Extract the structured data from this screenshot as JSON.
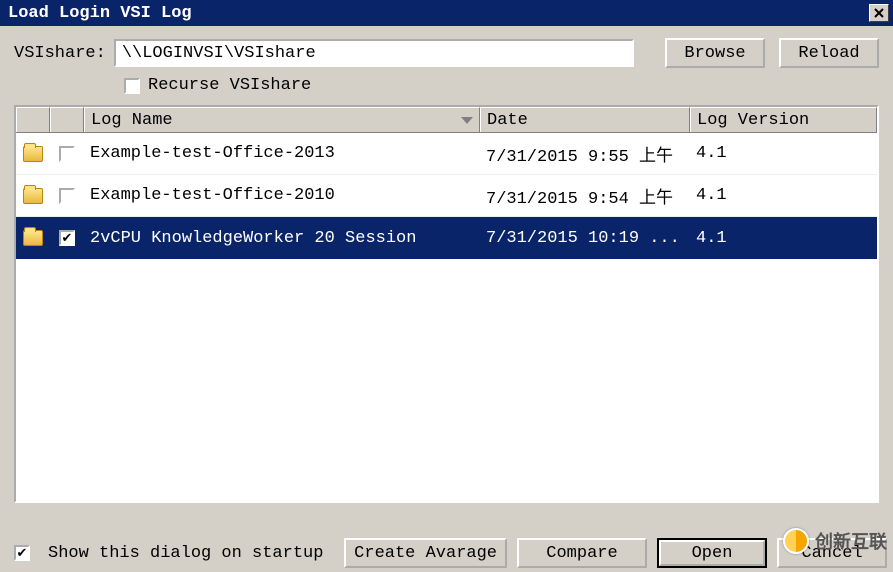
{
  "window": {
    "title": "Load Login VSI Log"
  },
  "form": {
    "share_label": "VSIshare:",
    "share_value": "\\\\LOGINVSI\\VSIshare",
    "browse": "Browse",
    "reload": "Reload",
    "recurse_label": "Recurse VSIshare",
    "recurse_checked": false
  },
  "columns": {
    "name": "Log Name",
    "date": "Date",
    "version": "Log Version"
  },
  "rows": [
    {
      "checked": false,
      "selected": false,
      "name": "Example-test-Office-2013",
      "date": "7/31/2015 9:55 上午",
      "version": "4.1"
    },
    {
      "checked": false,
      "selected": false,
      "name": "Example-test-Office-2010",
      "date": "7/31/2015 9:54 上午",
      "version": "4.1"
    },
    {
      "checked": true,
      "selected": true,
      "name": "2vCPU KnowledgeWorker 20 Session",
      "date": "7/31/2015 10:19 ...",
      "version": "4.1"
    }
  ],
  "footer": {
    "show_on_startup_label": "Show this dialog on startup",
    "show_on_startup_checked": true,
    "create_average": "Create Avarage",
    "compare": "Compare",
    "open": "Open",
    "cancel": "Cancel"
  },
  "watermark": "创新互联"
}
